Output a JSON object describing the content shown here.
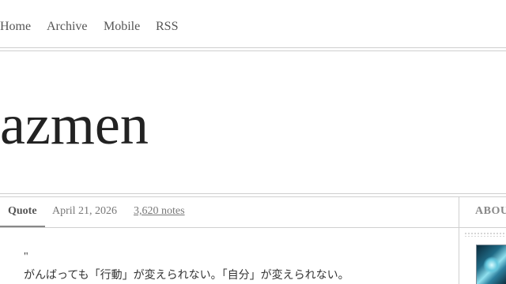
{
  "nav": {
    "home": "Home",
    "archive": "Archive",
    "mobile": "Mobile",
    "rss": "RSS"
  },
  "blog": {
    "title": "azmen"
  },
  "post": {
    "type": "Quote",
    "date": "April 21, 2026",
    "notes": "3,620 notes",
    "quote_mark": "\"",
    "quote_text": "がんばっても「行動」が変えられない。「自分」が変えられない。"
  },
  "sidebar": {
    "heading": "ABOUT"
  }
}
